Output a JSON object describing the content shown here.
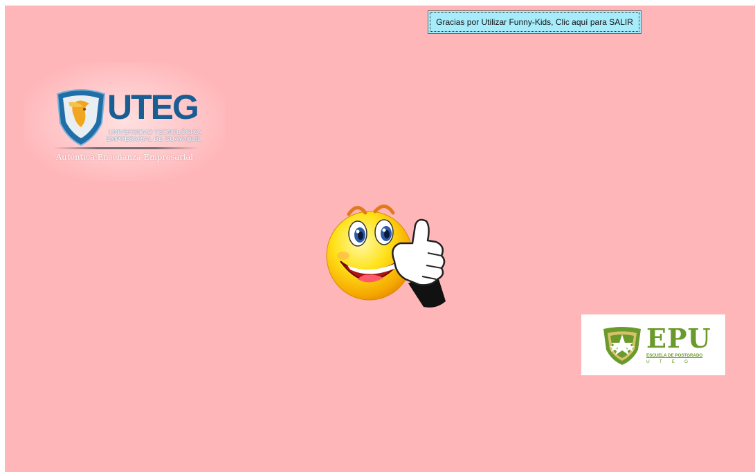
{
  "exit_button": {
    "label": "Gracias por Utilizar Funny-Kids, Clic aquí para SALIR"
  },
  "uteg_logo": {
    "name": "UTEG",
    "university_line1": "UNIVERSIDAD TECNOLÓGICA",
    "university_line2": "EMPRESARIAL DE GUAYAQUIL",
    "tagline": "Auténtica Enseñanza Empresarial"
  },
  "epu_logo": {
    "name": "EPU",
    "subtitle": "ESCUELA DE POSTGRADO",
    "letters": "UTEG"
  },
  "colors": {
    "background": "#ffb6b9",
    "button": "#a7ecfa",
    "uteg_blue": "#1a5d92",
    "epu_green": "#6b9a2c"
  },
  "icons": {
    "smiley": "thumbs-up-smiley-icon",
    "uteg": "uteg-shield-icon",
    "epu": "epu-badge-icon"
  }
}
